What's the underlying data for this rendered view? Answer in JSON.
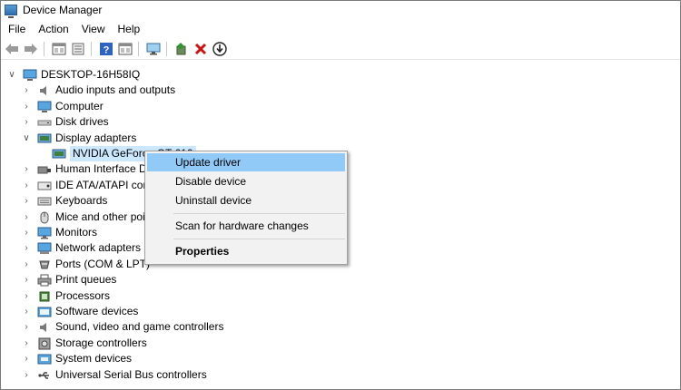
{
  "window": {
    "title": "Device Manager"
  },
  "menu": [
    "File",
    "Action",
    "View",
    "Help"
  ],
  "toolbar": {
    "buttons": [
      "back-arrow",
      "forward-arrow",
      "properties-window",
      "list-view",
      "help",
      "properties-window",
      "scan-monitor",
      "update-driver",
      "uninstall-x",
      "download-arrow"
    ]
  },
  "tree": {
    "root": "DESKTOP-16H58IQ",
    "categories": [
      {
        "label": "Audio inputs and outputs",
        "icon": "speaker-icon"
      },
      {
        "label": "Computer",
        "icon": "computer-icon"
      },
      {
        "label": "Disk drives",
        "icon": "disk-icon"
      },
      {
        "label": "Display adapters",
        "icon": "display-adapter-icon",
        "expanded": true
      },
      {
        "label": "Human Interface D",
        "icon": "hid-icon"
      },
      {
        "label": "IDE ATA/ATAPI cont",
        "icon": "ide-icon"
      },
      {
        "label": "Keyboards",
        "icon": "keyboard-icon"
      },
      {
        "label": "Mice and other poi",
        "icon": "mouse-icon"
      },
      {
        "label": "Monitors",
        "icon": "monitor-icon"
      },
      {
        "label": "Network adapters",
        "icon": "network-icon"
      },
      {
        "label": "Ports (COM & LPT)",
        "icon": "port-icon"
      },
      {
        "label": "Print queues",
        "icon": "printer-icon"
      },
      {
        "label": "Processors",
        "icon": "processor-icon"
      },
      {
        "label": "Software devices",
        "icon": "software-icon"
      },
      {
        "label": "Sound, video and game controllers",
        "icon": "speaker-icon"
      },
      {
        "label": "Storage controllers",
        "icon": "storage-icon"
      },
      {
        "label": "System devices",
        "icon": "system-icon"
      },
      {
        "label": "Universal Serial Bus controllers",
        "icon": "usb-icon"
      }
    ],
    "display_child": "NVIDIA GeForce GT 610"
  },
  "context_menu": {
    "update": "Update driver",
    "disable": "Disable device",
    "uninstall": "Uninstall device",
    "scan": "Scan for hardware changes",
    "properties": "Properties"
  },
  "colors": {
    "selection": "#cce8ff",
    "menu_highlight": "#91c9f7",
    "menu_bg": "#f2f2f2"
  }
}
